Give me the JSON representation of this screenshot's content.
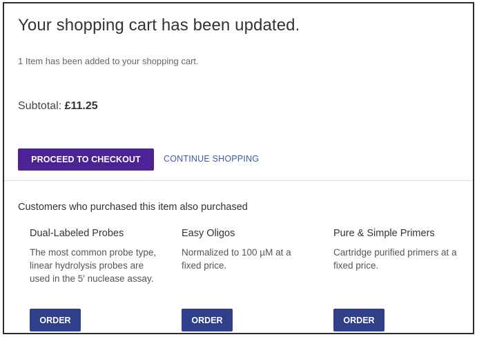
{
  "cart": {
    "title": "Your shopping cart has been updated.",
    "added_message": "1 Item has been added to your shopping cart.",
    "subtotal_label": "Subtotal:",
    "subtotal_value": "£11.25",
    "checkout_label": "PROCEED TO CHECKOUT",
    "continue_label": "CONTINUE SHOPPING"
  },
  "also": {
    "heading": "Customers who purchased this item also purchased",
    "products": [
      {
        "name": "Dual-Labeled Probes",
        "description": "The most common probe type, linear hydrolysis probes are used in the 5' nuclease assay.",
        "order_label": "ORDER"
      },
      {
        "name": "Easy Oligos",
        "description": "Normalized to 100 µM at a fixed price.",
        "order_label": "ORDER"
      },
      {
        "name": "Pure & Simple Primers",
        "description": "Cartridge purified primers at a fixed price.",
        "order_label": "ORDER"
      }
    ]
  },
  "colors": {
    "checkout_button": "#4b2395",
    "order_button": "#2f3f8a",
    "link": "#3b5aa8"
  }
}
